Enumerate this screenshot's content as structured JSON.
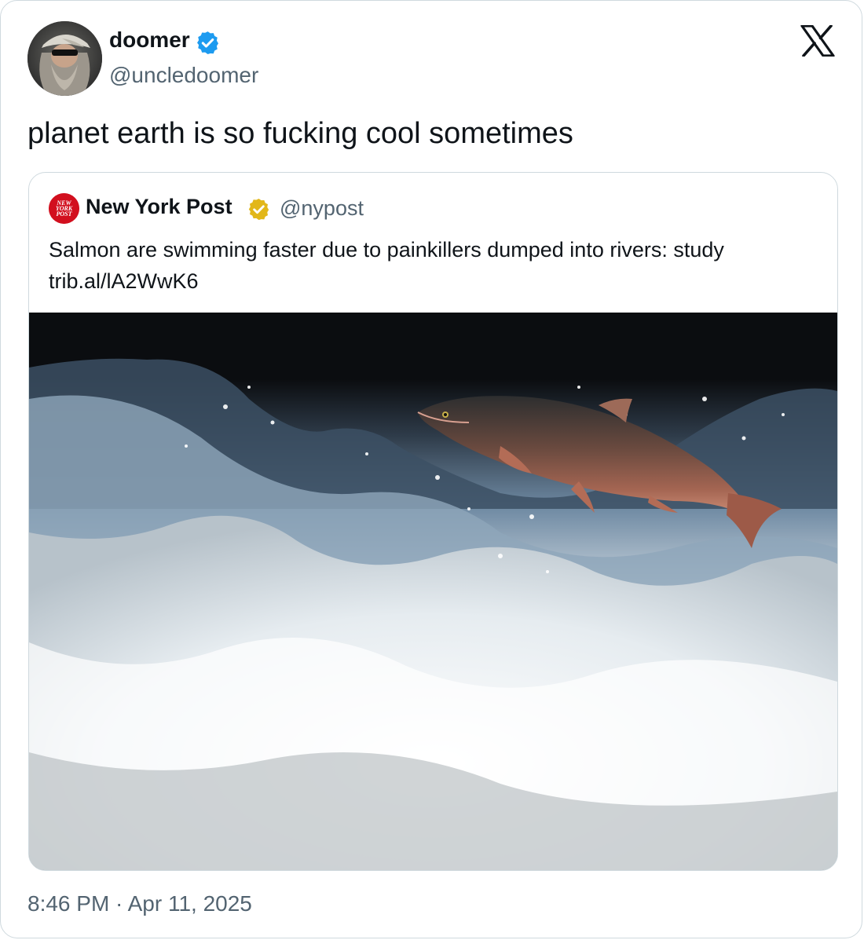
{
  "tweet": {
    "author": {
      "display_name": "doomer",
      "handle": "@uncledoomer",
      "verified": true,
      "verified_color": "#1d9bf0"
    },
    "text": "planet earth is so fucking cool sometimes",
    "timestamp": "8:46 PM · Apr 11, 2025",
    "brand_icon": "x-logo-icon"
  },
  "quoted_tweet": {
    "author": {
      "display_name": "New York Post",
      "handle": "@nypost",
      "verified": true,
      "verified_color": "#e2b719",
      "avatar_text": [
        "NEW",
        "YORK",
        "POST"
      ]
    },
    "text_line1": "Salmon are swimming faster due to painkillers dumped into rivers: study",
    "text_line2": "trib.al/lA2WwK6",
    "media_description_icon": "salmon-photo"
  },
  "colors": {
    "text_primary": "#0f1419",
    "text_secondary": "#536471",
    "border": "#cfd9de"
  }
}
